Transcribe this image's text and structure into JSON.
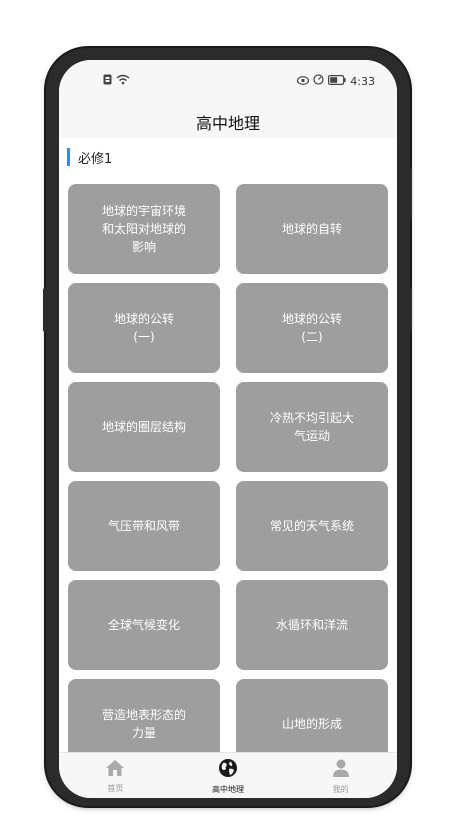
{
  "status": {
    "time": "4:33"
  },
  "header": {
    "title": "高中地理"
  },
  "section": {
    "label": "必修1"
  },
  "tiles": [
    {
      "label": "地球的宇宙环境\n和太阳对地球的\n影响"
    },
    {
      "label": "地球的自转"
    },
    {
      "label": "地球的公转\n(一)"
    },
    {
      "label": "地球的公转\n(二)"
    },
    {
      "label": "地球的圈层结构"
    },
    {
      "label": "冷热不均引起大\n气运动"
    },
    {
      "label": "气压带和风带"
    },
    {
      "label": "常见的天气系统"
    },
    {
      "label": "全球气候变化"
    },
    {
      "label": "水循环和洋流"
    },
    {
      "label": "营造地表形态的\n力量"
    },
    {
      "label": "山地的形成"
    }
  ],
  "nav": {
    "items": [
      {
        "label": "首页",
        "icon": "home-icon"
      },
      {
        "label": "高中地理",
        "icon": "globe-icon"
      },
      {
        "label": "我的",
        "icon": "user-icon"
      }
    ],
    "active_index": 1
  },
  "colors": {
    "accent": "#1e90ff",
    "tile": "#9e9e9e",
    "frame": "#2b2b2b"
  }
}
